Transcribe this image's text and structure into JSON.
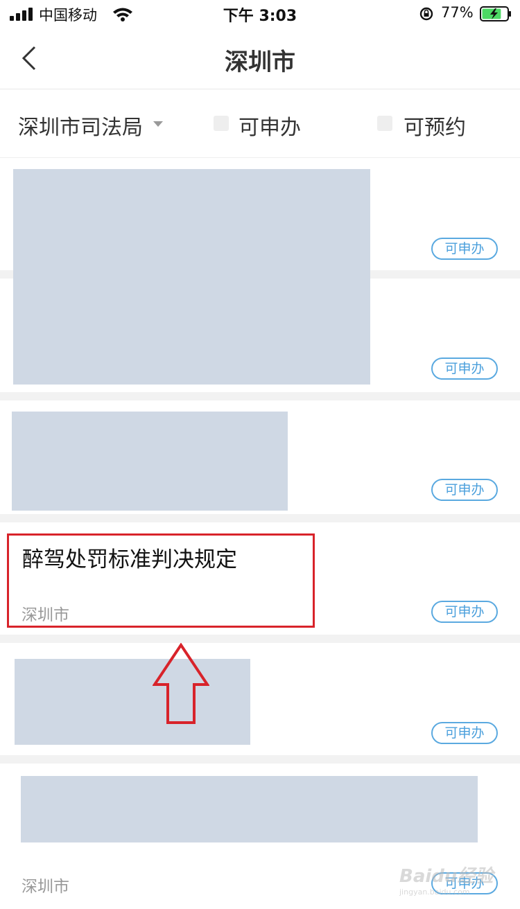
{
  "status_bar": {
    "carrier": "中国移动",
    "time": "下午 3:03",
    "battery_percent": "77%",
    "battery_level": 0.77,
    "icons": [
      "signal-icon",
      "wifi-icon",
      "rotation-lock-icon",
      "battery-charging-icon"
    ]
  },
  "nav": {
    "title": "深圳市",
    "back_icon": "back-chevron-icon"
  },
  "filters": {
    "department": "深圳市司法局",
    "checkbox_applicable": "可申办",
    "checkbox_bookable": "可预约"
  },
  "list": {
    "badge_label": "可申办",
    "items": [
      {
        "title": "",
        "subtitle": "",
        "badge": "可申办",
        "redacted": true
      },
      {
        "title": "",
        "subtitle": "",
        "badge": "可申办",
        "redacted": true
      },
      {
        "title": "",
        "subtitle": "",
        "badge": "可申办",
        "redacted": true
      },
      {
        "title": "醉驾处罚标准判决规定",
        "subtitle": "深圳市",
        "badge": "可申办",
        "redacted": false
      },
      {
        "title": "",
        "subtitle": "",
        "badge": "可申办",
        "redacted": true
      },
      {
        "title": "",
        "subtitle": "深圳市",
        "badge": "可申办",
        "redacted": true
      }
    ]
  },
  "annotation": {
    "highlight_color": "#d8232a",
    "arrow_direction": "up"
  },
  "watermark": {
    "brand": "Baidu经验",
    "url": "jingyan.baidu.com"
  },
  "colors": {
    "accent": "#4a9fdc",
    "placeholder_block": "#cfd8e4",
    "separator": "#f2f2f2"
  }
}
